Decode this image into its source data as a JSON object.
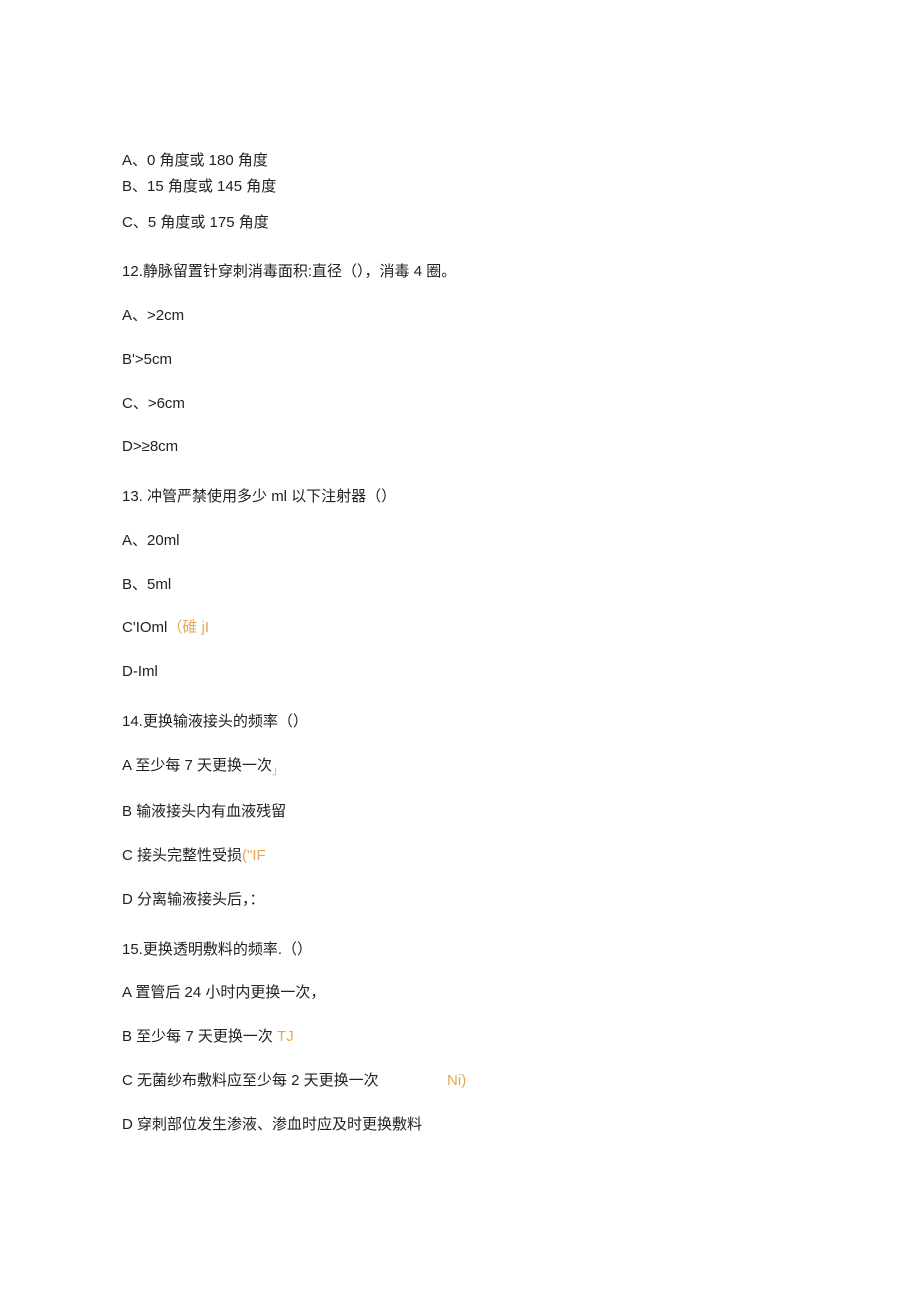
{
  "q11": {
    "optA": "A、0 角度或 180 角度",
    "optB": "B、15 角度或 145 角度",
    "optC": "C、5 角度或 175 角度"
  },
  "q12": {
    "stem": "12.静脉留置针穿刺消毒面积:直径（），消毒 4 圈。",
    "optA": "A、>2cm",
    "optB": "B'>5cm",
    "optC": "C、>6cm",
    "optD": "D>≥8cm"
  },
  "q13": {
    "stem": "13. 冲管严禁使用多少 ml 以下注射器（）",
    "optA": "A、20ml",
    "optB": "B、5ml",
    "optC_pre": "C'IOml",
    "optC_note": "（碓 jI",
    "optD": "D-Iml"
  },
  "q14": {
    "stem": "14.更换输液接头的频率（）",
    "optA_pre": "A 至少每 7 天更换一次",
    "optA_sub": "」",
    "optB": "B 输液接头内有血液残留",
    "optC_pre": "C 接头完整性受损",
    "optC_note": "(\"IF",
    "optD": "D 分离输液接头后，："
  },
  "q15": {
    "stem": "15.更换透明敷料的频率.（）",
    "optA": "A 置管后 24 小时内更换一次，",
    "optB_pre": "B 至少每 7 天更换一次",
    "optB_note": " TJ",
    "optC_pre": "C 无菌纱布敷料应至少每 2 天更换一次",
    "optC_note": "Ni)",
    "optD": "D 穿刺部位发生渗液、渗血时应及时更换敷料"
  }
}
